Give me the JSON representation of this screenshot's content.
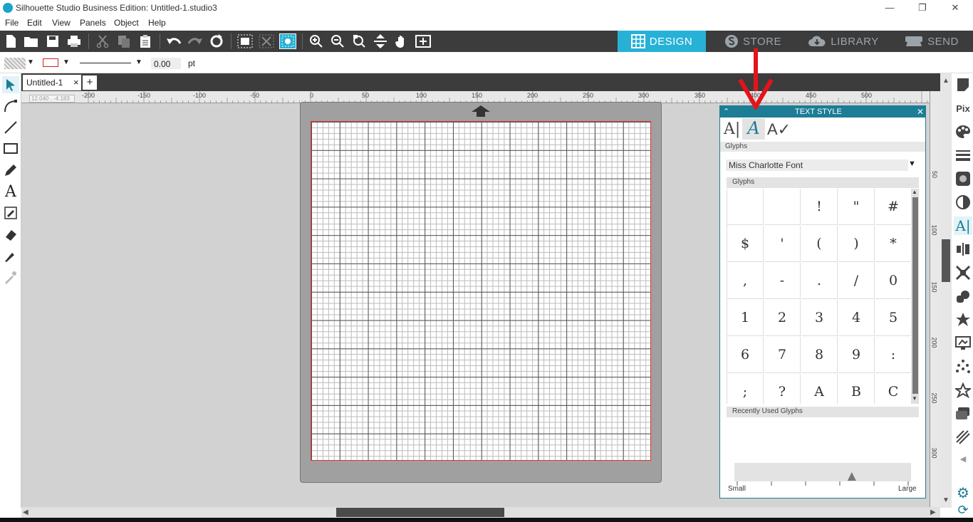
{
  "window": {
    "title": "Silhouette Studio Business Edition: Untitled-1.studio3",
    "minimize": "—",
    "restore": "❐",
    "close": "✕"
  },
  "menu": [
    "File",
    "Edit",
    "View",
    "Panels",
    "Object",
    "Help"
  ],
  "nav_tabs": [
    {
      "label": "DESIGN",
      "icon": "grid-icon",
      "active": true
    },
    {
      "label": "STORE",
      "icon": "silhouette-s-icon",
      "active": false
    },
    {
      "label": "LIBRARY",
      "icon": "cloud-download-icon",
      "active": false
    },
    {
      "label": "SEND",
      "icon": "cutter-icon",
      "active": false
    }
  ],
  "options_bar": {
    "line_width": "0.00",
    "unit": "pt"
  },
  "document_tab": {
    "name": "Untitled-1",
    "close": "×",
    "add": "+"
  },
  "ruler": {
    "coord_readout": "12.040 , -4.183",
    "top_labels": [
      "-200",
      "-150",
      "-100",
      "-50",
      "0",
      "50",
      "100",
      "150",
      "200",
      "250",
      "300",
      "350",
      "400",
      "450",
      "500"
    ],
    "right_labels": [
      "50",
      "100",
      "150",
      "200",
      "250",
      "300"
    ]
  },
  "text_style_panel": {
    "title": "TEXT STYLE",
    "section_label": "Glyphs",
    "font_name": "Miss Charlotte Font",
    "glyphs_header": "Glyphs",
    "glyphs": [
      "",
      "",
      "!",
      "\"",
      "#",
      "$",
      "'",
      "(",
      ")",
      "*",
      ",",
      "-",
      ".",
      "/",
      "0",
      "1",
      "2",
      "3",
      "4",
      "5",
      "6",
      "7",
      "8",
      "9",
      ":",
      ";",
      "?",
      "A",
      "B",
      "C"
    ],
    "recent_header": "Recently Used Glyphs",
    "size_small": "Small",
    "size_large": "Large",
    "size_level": 0.67
  },
  "annotation": {
    "arrow_color": "#e4141b"
  },
  "colors": {
    "accent": "#27b1d6",
    "panel_header": "#1c7d95",
    "toolbar": "#3c3c3c"
  }
}
